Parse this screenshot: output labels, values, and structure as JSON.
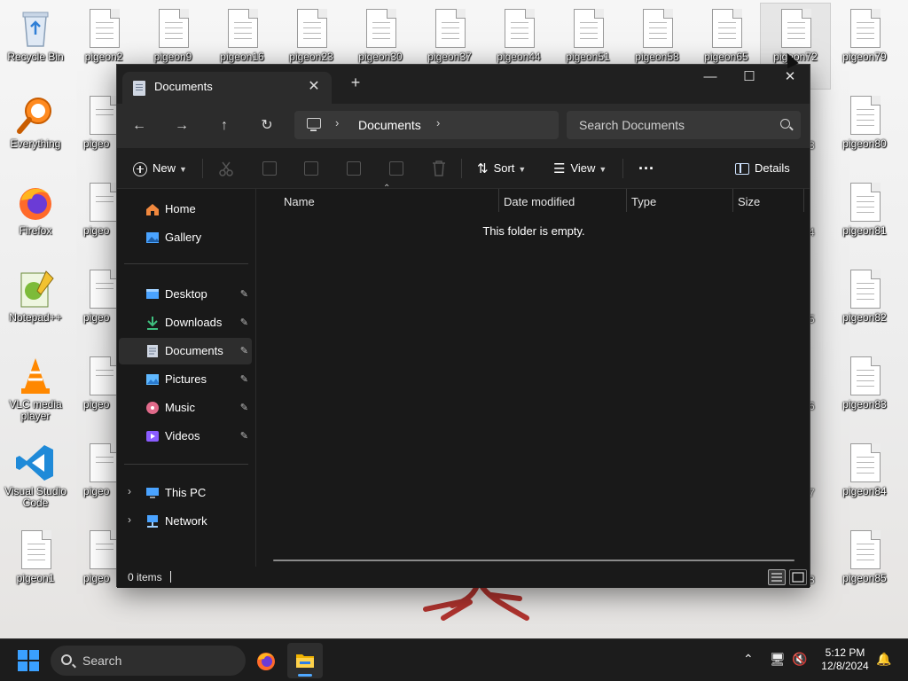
{
  "desktop": {
    "icons_col1": [
      {
        "label": "Recycle Bin",
        "icon": "recycle-bin-icon"
      },
      {
        "label": "Everything",
        "icon": "everything-search-icon"
      },
      {
        "label": "Firefox",
        "icon": "firefox-icon"
      },
      {
        "label": "Notepad++",
        "icon": "notepadpp-icon"
      },
      {
        "label": "VLC media player",
        "icon": "vlc-icon"
      },
      {
        "label": "Visual Studio Code",
        "icon": "vscode-icon"
      },
      {
        "label": "pigeon1",
        "icon": "document-icon"
      }
    ],
    "top_row": [
      "pigeon2",
      "pigeon9",
      "pigeon16",
      "pigeon23",
      "pigeon30",
      "pigeon37",
      "pigeon44",
      "pigeon51",
      "pigeon58",
      "pigeon65",
      "pigeon72",
      "pigeon79"
    ],
    "right_col": [
      "pigeon80",
      "pigeon81",
      "pigeon82",
      "pigeon83",
      "pigeon84",
      "pigeon85"
    ],
    "col2_partial": [
      "pigeo",
      "pigeo",
      "pigeo",
      "pigeo",
      "pigeo",
      "pigeo"
    ],
    "col_right_partial": [
      "3",
      "4",
      "5",
      "6",
      "7",
      "8"
    ]
  },
  "window": {
    "tab_title": "Documents",
    "tab_close": "✕",
    "new_tab": "+",
    "minimize": "—",
    "maximize": "☐",
    "close": "✕",
    "nav": {
      "back": "←",
      "forward": "→",
      "up": "↑",
      "refresh": "↻"
    },
    "breadcrumb": [
      "Documents"
    ],
    "search_placeholder": "Search Documents",
    "toolbar": {
      "new_label": "New",
      "sort_label": "Sort",
      "view_label": "View",
      "more_label": "···",
      "details_label": "Details"
    },
    "sidebar": {
      "quick": [
        {
          "label": "Home",
          "icon": "home-icon",
          "color": "#f0883e"
        },
        {
          "label": "Gallery",
          "icon": "gallery-icon",
          "color": "#4aa3ff"
        }
      ],
      "pinned": [
        {
          "label": "Desktop",
          "icon": "desktop-folder-icon",
          "color": "#4aa3ff",
          "active": false
        },
        {
          "label": "Downloads",
          "icon": "downloads-icon",
          "color": "#3fbf7f",
          "active": false
        },
        {
          "label": "Documents",
          "icon": "documents-icon",
          "color": "#cfd6e2",
          "active": true
        },
        {
          "label": "Pictures",
          "icon": "pictures-icon",
          "color": "#5fb8ff",
          "active": false
        },
        {
          "label": "Music",
          "icon": "music-icon",
          "color": "#e06a8a",
          "active": false
        },
        {
          "label": "Videos",
          "icon": "videos-icon",
          "color": "#8a5cff",
          "active": false
        }
      ],
      "locations": [
        {
          "label": "This PC",
          "icon": "this-pc-icon",
          "color": "#4aa3ff"
        },
        {
          "label": "Network",
          "icon": "network-icon",
          "color": "#4aa3ff"
        }
      ],
      "pin_glyph": "📌"
    },
    "columns": [
      "Name",
      "Date modified",
      "Type",
      "Size"
    ],
    "empty_message": "This folder is empty.",
    "status": {
      "items": "0 items"
    }
  },
  "taskbar": {
    "search_label": "Search",
    "time": "5:12 PM",
    "date": "12/8/2024",
    "accent": "#4fa8ff"
  }
}
